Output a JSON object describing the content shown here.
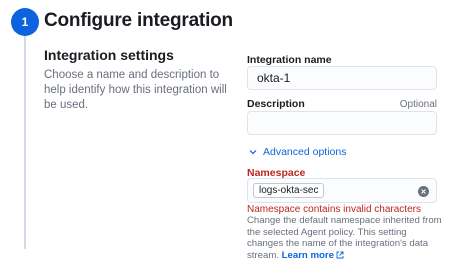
{
  "step": {
    "number": "1",
    "title": "Configure integration"
  },
  "settings": {
    "title": "Integration settings",
    "description": "Choose a name and description to help identify how this integration will be used."
  },
  "form": {
    "name_label": "Integration name",
    "name_value": "okta-1",
    "description_label": "Description",
    "description_optional": "Optional",
    "description_value": "",
    "advanced_label": "Advanced options",
    "namespace_label": "Namespace",
    "namespace_value": "logs-okta-sec",
    "namespace_error": "Namespace contains invalid characters",
    "namespace_help": "Change the default namespace inherited from the selected Agent policy. This setting changes the name of the integration's data stream.",
    "learn_more": "Learn more"
  },
  "colors": {
    "primary": "#0b64dd",
    "danger": "#bd271e",
    "subdued": "#69707d"
  }
}
